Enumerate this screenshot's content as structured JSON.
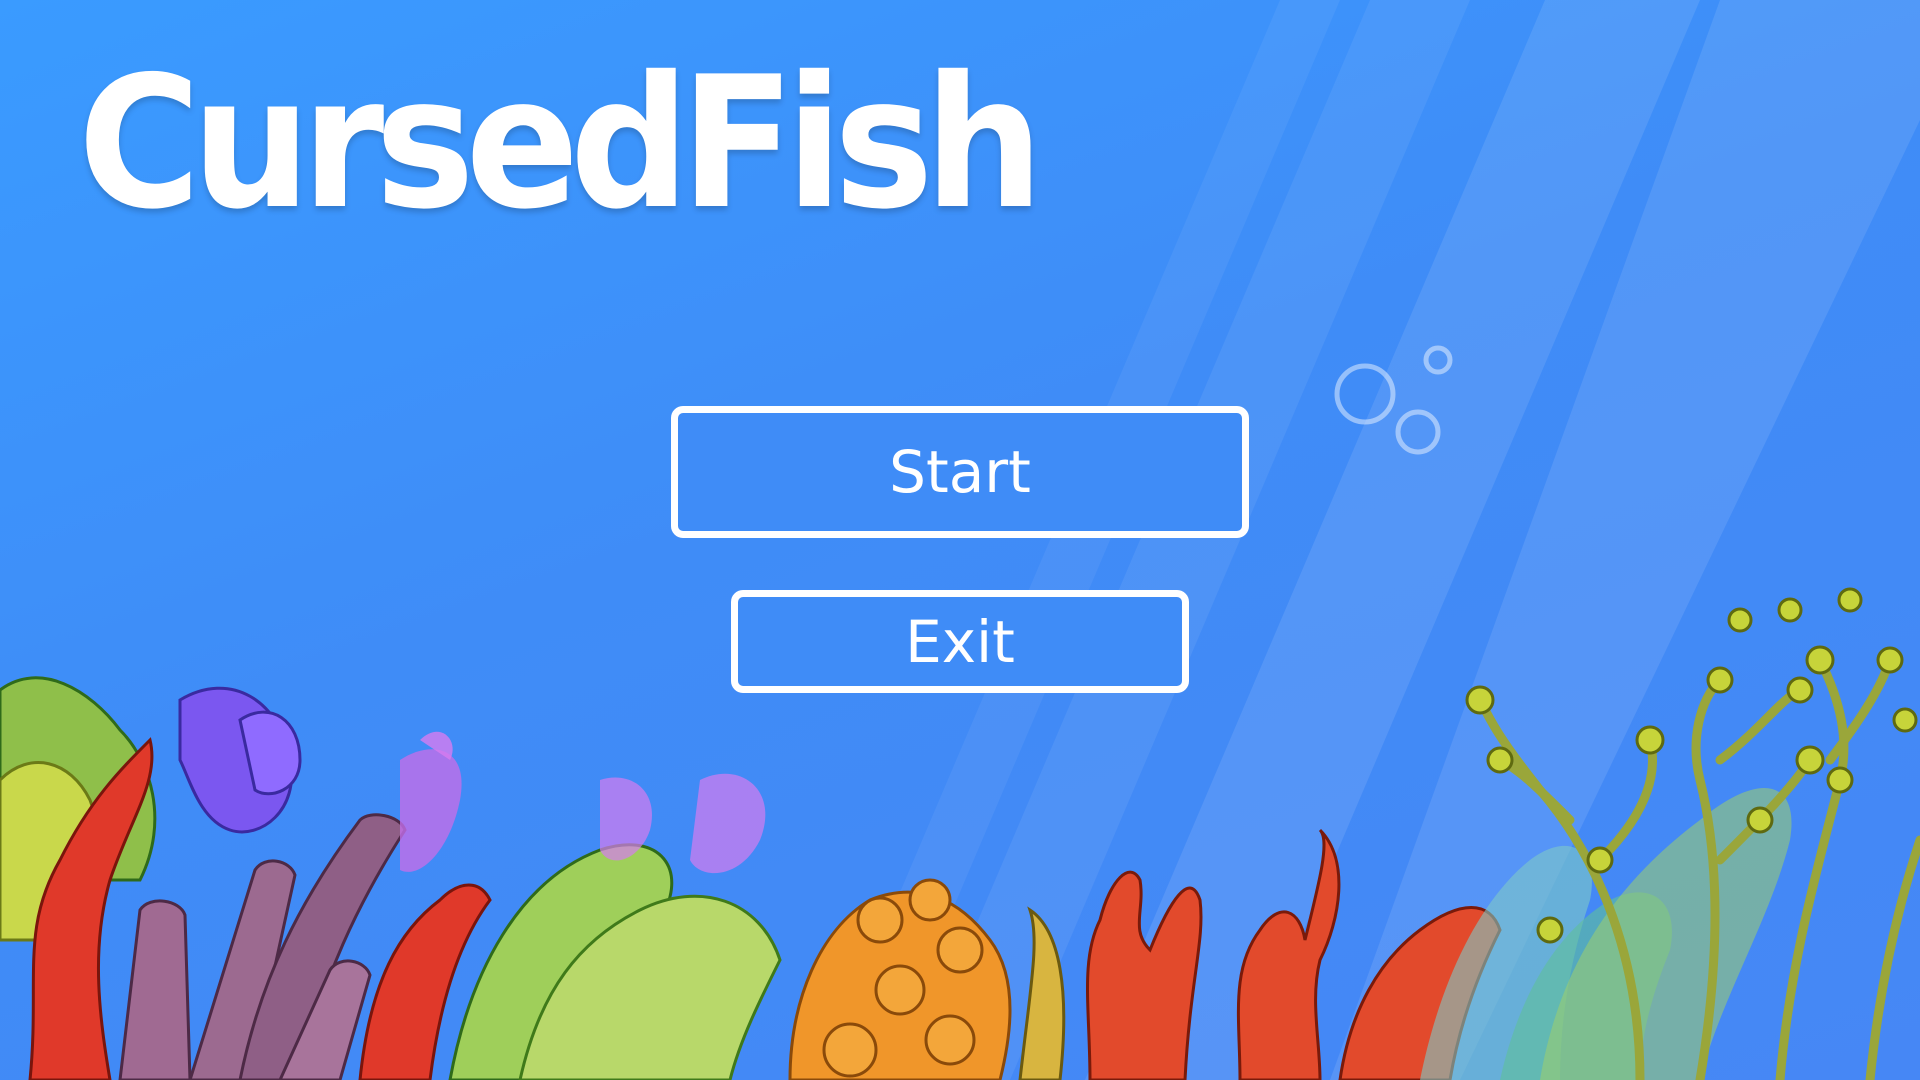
{
  "game": {
    "title": "CursedFish"
  },
  "menu": {
    "start_label": "Start",
    "exit_label": "Exit"
  },
  "colors": {
    "background_top": "#3a9bff",
    "background_bottom": "#4687f5",
    "title": "#ffffff",
    "button_border": "#ffffff",
    "button_fill": "#3f8cf7"
  }
}
